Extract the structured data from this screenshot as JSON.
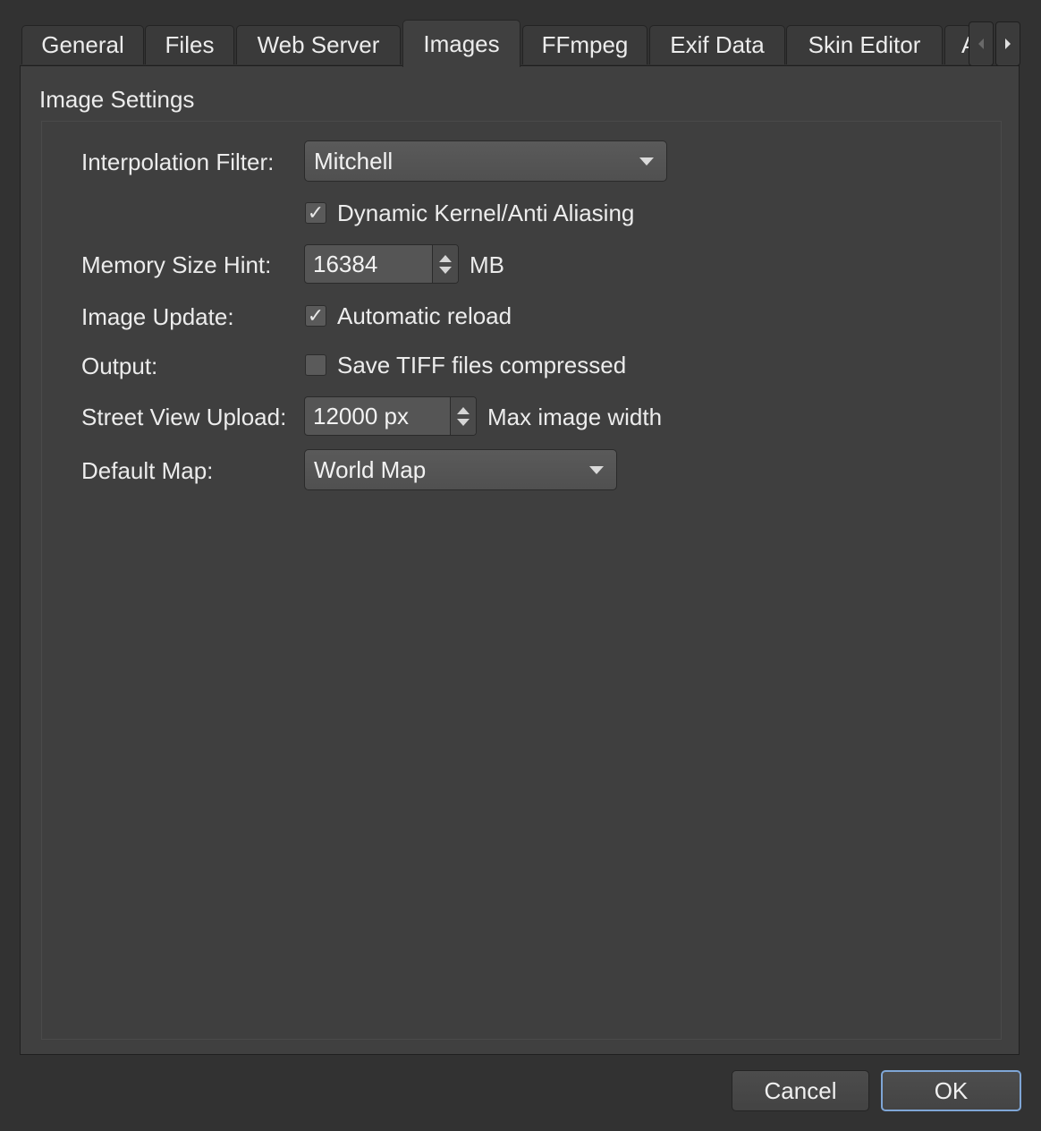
{
  "tabs": [
    {
      "label": "General"
    },
    {
      "label": "Files"
    },
    {
      "label": "Web Server"
    },
    {
      "label": "Images",
      "active": true
    },
    {
      "label": "FFmpeg"
    },
    {
      "label": "Exif Data"
    },
    {
      "label": "Skin Editor"
    },
    {
      "label": "A"
    }
  ],
  "tab_scroll": {
    "left_icon": "tab-scroll-left-icon",
    "right_icon": "tab-scroll-right-icon"
  },
  "image_settings": {
    "title": "Image Settings",
    "interpolation_filter": {
      "label": "Interpolation Filter:",
      "value": "Mitchell"
    },
    "dynamic_kernel": {
      "label": "Dynamic Kernel/Anti Aliasing",
      "checked": true
    },
    "memory_size_hint": {
      "label": "Memory Size Hint:",
      "value": "16384",
      "unit": "MB"
    },
    "image_update": {
      "label": "Image Update:",
      "checkbox_label": "Automatic reload",
      "checked": true
    },
    "output": {
      "label": "Output:",
      "checkbox_label": "Save TIFF files compressed",
      "checked": false
    },
    "street_view_upload": {
      "label": "Street View Upload:",
      "value": "12000 px",
      "suffix": "Max image width"
    },
    "default_map": {
      "label": "Default Map:",
      "value": "World Map"
    }
  },
  "footer": {
    "cancel_label": "Cancel",
    "ok_label": "OK"
  },
  "colors": {
    "background": "#323232",
    "pane": "#404040",
    "default_button_border": "#7fa6d6"
  }
}
